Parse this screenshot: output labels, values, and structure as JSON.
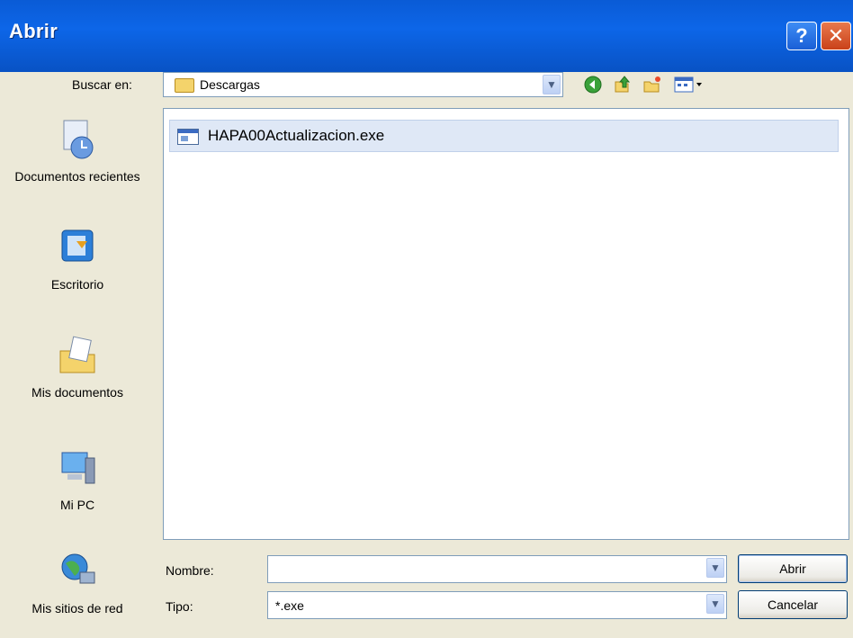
{
  "window": {
    "title": "Abrir",
    "help_glyph": "?",
    "close_glyph": "✕"
  },
  "lookin": {
    "label": "Buscar en:",
    "value": "Descargas"
  },
  "places": [
    {
      "label": "Documentos recientes",
      "icon": "recent-documents-icon"
    },
    {
      "label": "Escritorio",
      "icon": "desktop-icon"
    },
    {
      "label": "Mis documentos",
      "icon": "my-documents-icon"
    },
    {
      "label": "Mi PC",
      "icon": "my-computer-icon"
    },
    {
      "label": "Mis sitios de red",
      "icon": "network-places-icon"
    }
  ],
  "files": [
    {
      "name": "HAPA00Actualizacion.exe",
      "icon": "exe-file-icon"
    }
  ],
  "name_field": {
    "label": "Nombre:",
    "value": ""
  },
  "type_field": {
    "label": "Tipo:",
    "value": "*.exe"
  },
  "buttons": {
    "open": "Abrir",
    "cancel": "Cancelar"
  },
  "colors": {
    "titlebar": "#0a5bd6",
    "dialog_bg": "#ece9d8",
    "selection": "#dfe8f6"
  }
}
